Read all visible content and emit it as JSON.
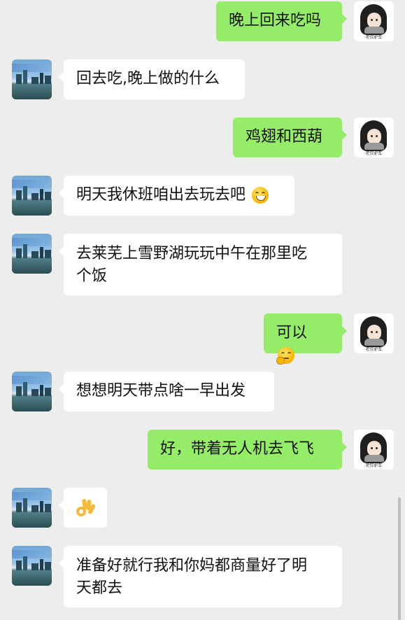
{
  "messages": [
    {
      "side": "right",
      "text": "晚上回来吃吗"
    },
    {
      "side": "left",
      "text": "回去吃,晚上做的什么"
    },
    {
      "side": "right",
      "text": "鸡翅和西葫"
    },
    {
      "side": "left",
      "text": "明天我休班咱出去玩去吧",
      "emoji": "grin-emoji"
    },
    {
      "side": "left",
      "text_line1": "去莱芜上雪野湖玩玩中午在那里吃",
      "text_line2": "个饭"
    },
    {
      "side": "right",
      "text": "可以",
      "emoji": "thinking-emoji"
    },
    {
      "side": "left",
      "text": "想想明天带点啥一早出发"
    },
    {
      "side": "right",
      "text": "好，带着无人机去飞飞"
    },
    {
      "side": "left",
      "emoji": "ok-hand-emoji"
    },
    {
      "side": "left",
      "text_line1": "准备好就行我和你妈都商量好了明",
      "text_line2": "天都去"
    }
  ],
  "avatar_right_tag": "老仅驴车",
  "colors": {
    "background": "#ededed",
    "self_bubble": "#95ec69",
    "other_bubble": "#ffffff"
  }
}
